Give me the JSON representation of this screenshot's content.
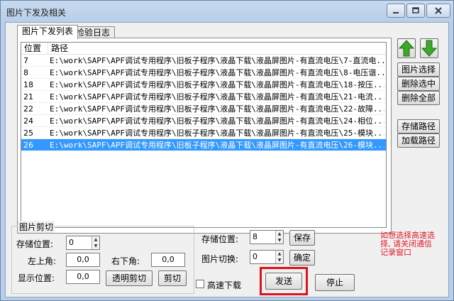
{
  "window": {
    "title": "图片下发及相关"
  },
  "tabs": [
    {
      "label": "图片下发列表"
    },
    {
      "label": "检验日志"
    }
  ],
  "list": {
    "columns": [
      "位置",
      "路径"
    ],
    "rows": [
      {
        "pos": "7",
        "path": "E:\\work\\SAPF\\APF调试专用程序\\旧板子程序\\液晶下载\\液晶屏图片-有直流电压\\7-直流电..."
      },
      {
        "pos": "8",
        "path": "E:\\work\\SAPF\\APF调试专用程序\\旧板子程序\\液晶下载\\液晶屏图片-有直流电压\\8-电压谐..."
      },
      {
        "pos": "18",
        "path": "E:\\work\\SAPF\\APF调试专用程序\\旧板子程序\\液晶下载\\液晶屏图片-有直流电压\\18-按压..."
      },
      {
        "pos": "21",
        "path": "E:\\work\\SAPF\\APF调试专用程序\\旧板子程序\\液晶下载\\液晶屏图片-有直流电压\\21-电流..."
      },
      {
        "pos": "22",
        "path": "E:\\work\\SAPF\\APF调试专用程序\\旧板子程序\\液晶下载\\液晶屏图片-有直流电压\\22-故障..."
      },
      {
        "pos": "24",
        "path": "E:\\work\\SAPF\\APF调试专用程序\\旧板子程序\\液晶下载\\液晶屏图片-有直流电压\\24-相位..."
      },
      {
        "pos": "25",
        "path": "E:\\work\\SAPF\\APF调试专用程序\\旧板子程序\\液晶下载\\液晶屏图片-有直流电压\\25-模块..."
      },
      {
        "pos": "26",
        "path": "E:\\work\\SAPF\\APF调试专用程序\\旧板子程序\\液晶下载\\液晶屏图片-有直流电压\\26-模块..."
      }
    ],
    "selected_pos": "26"
  },
  "side_buttons": {
    "select_image": "图片选择",
    "delete_selected": "删除选中",
    "delete_all": "删除全部",
    "save_path": "存储路径",
    "load_path": "加载路径"
  },
  "crop": {
    "group_title": "图片剪切",
    "store_pos_label": "存储位置:",
    "store_pos_value": "0",
    "top_left_label": "左上角:",
    "top_left_value": "0,0",
    "bottom_right_label": "右下角:",
    "bottom_right_value": "0,0",
    "display_pos_label": "显示位置:",
    "display_pos_value": "0,0",
    "transparent_crop_button": "透明剪切",
    "crop_button": "剪切"
  },
  "storage": {
    "store_pos_label": "存储位置:",
    "store_pos_value": "8",
    "save_button": "保存",
    "image_switch_label": "图片切换:",
    "image_switch_value": "0",
    "confirm_button": "确定"
  },
  "bottom": {
    "fast_download_label": "高速下载",
    "fast_download_checked": false,
    "send_button": "发送",
    "stop_button": "停止"
  },
  "note": {
    "text": "如想选择高速选\n择, 请关闭通信\n记录窗口"
  },
  "colors": {
    "selection": "#3399ff",
    "note": "#e0192a",
    "highlight": "#e0101a",
    "arrow_green": "#3ea82b"
  }
}
